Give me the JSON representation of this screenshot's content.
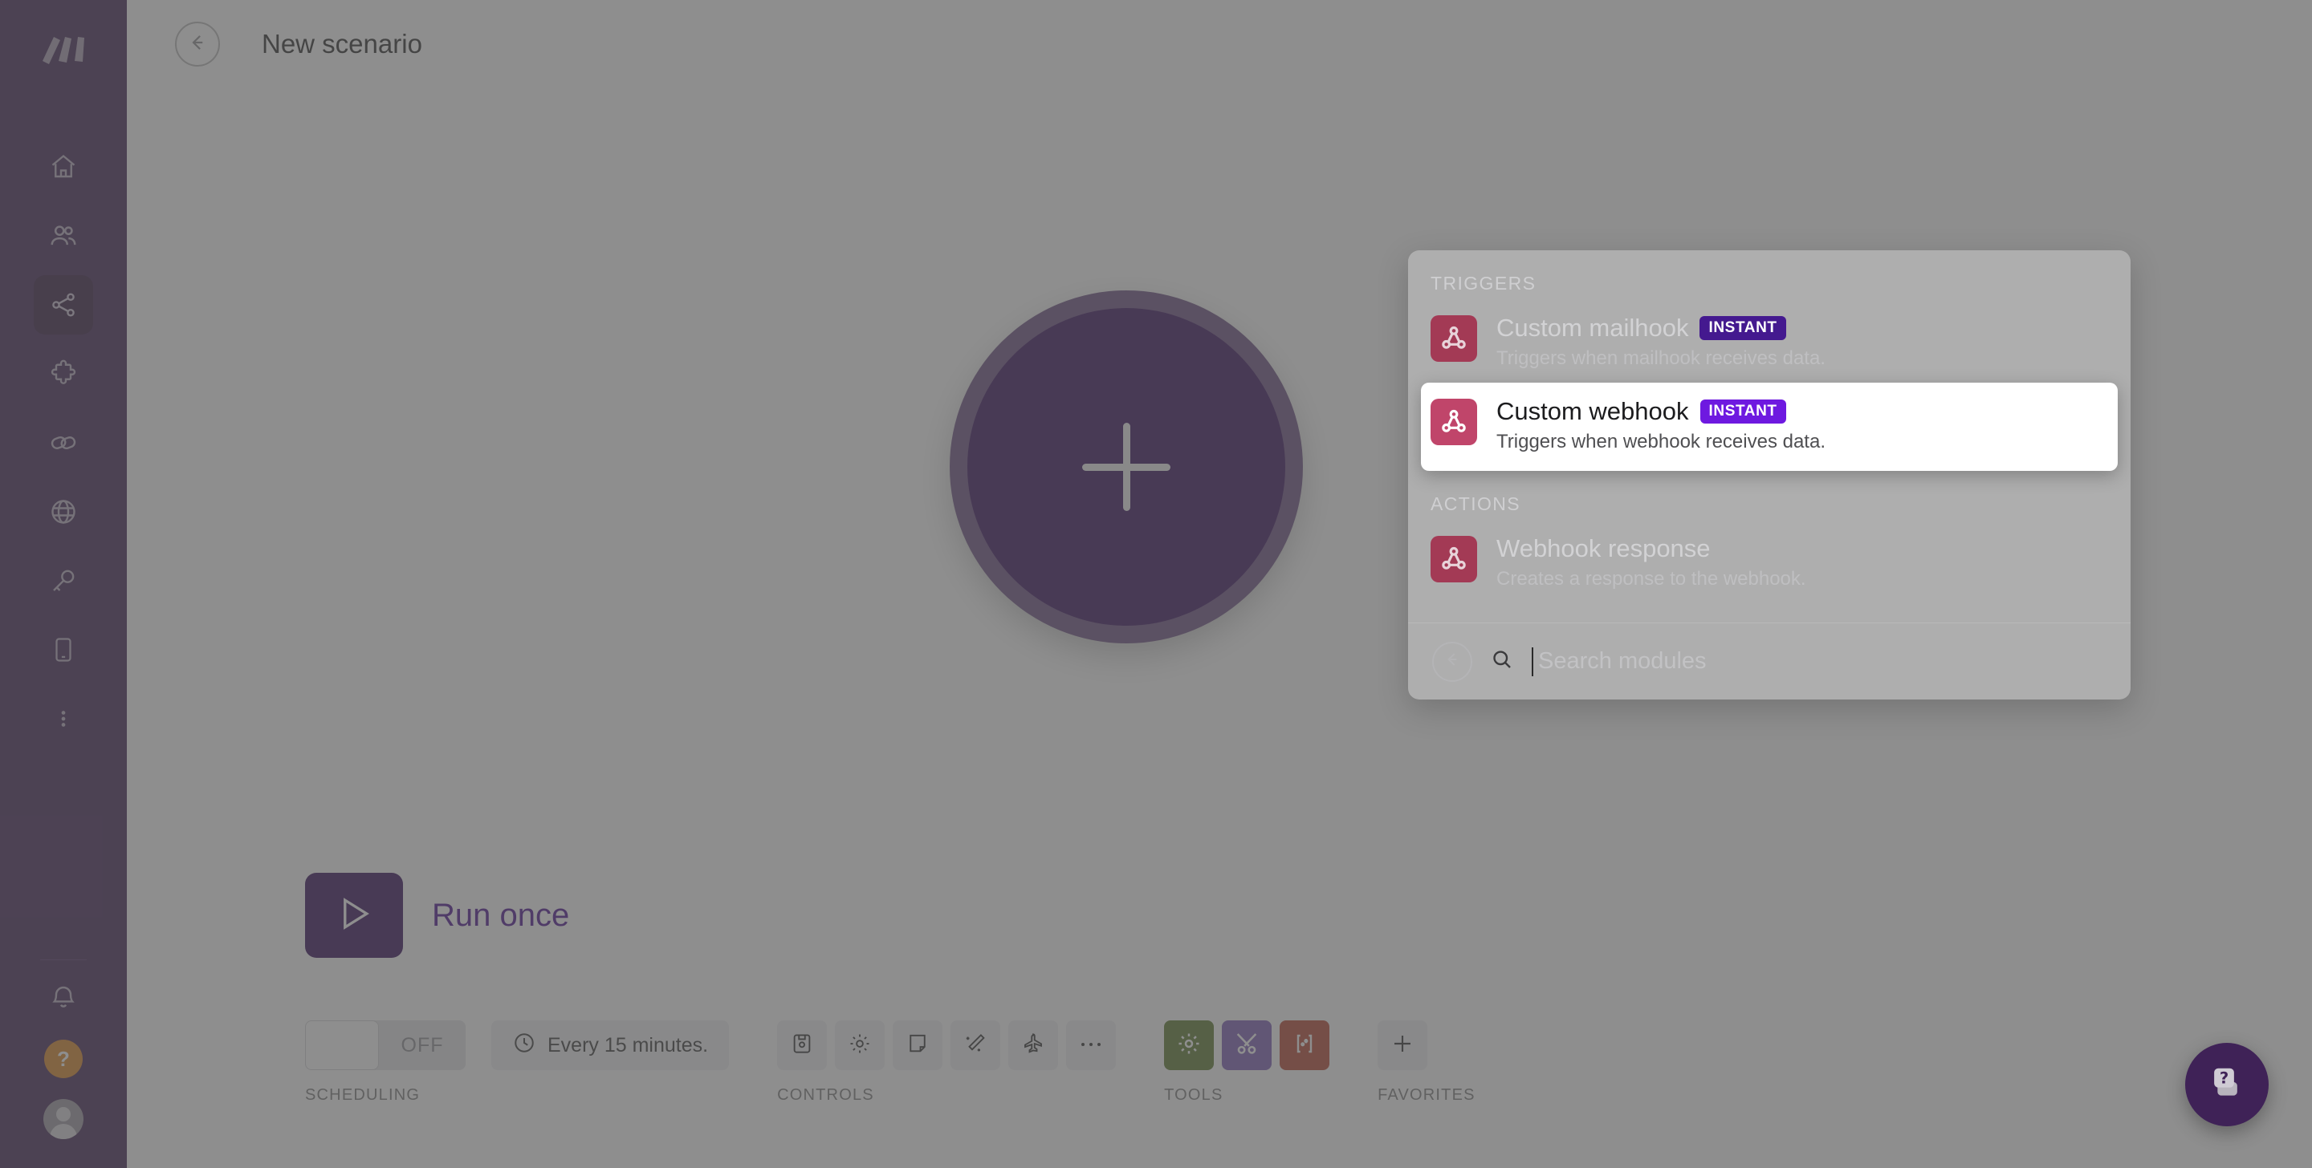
{
  "app": {
    "name": "Make",
    "logo_icon": "make-logo-icon"
  },
  "sidebar": {
    "items": [
      {
        "name": "home",
        "icon": "home-icon",
        "active": false
      },
      {
        "name": "team",
        "icon": "people-icon",
        "active": false
      },
      {
        "name": "scenarios",
        "icon": "share-nodes-icon",
        "active": true
      },
      {
        "name": "templates",
        "icon": "puzzle-piece-icon",
        "active": false
      },
      {
        "name": "connections",
        "icon": "link-icon",
        "active": false
      },
      {
        "name": "webhooks",
        "icon": "globe-icon",
        "active": false
      },
      {
        "name": "keys",
        "icon": "key-icon",
        "active": false
      },
      {
        "name": "devices",
        "icon": "device-icon",
        "active": false
      },
      {
        "name": "more",
        "icon": "more-vertical-icon",
        "active": false
      }
    ],
    "bottom": {
      "notifications_icon": "bell-icon",
      "help_icon": "question-mark-icon",
      "help_label": "?",
      "avatar_icon": "user-avatar-icon"
    }
  },
  "header": {
    "back_icon": "arrow-left-circle-icon",
    "title": "New scenario"
  },
  "canvas": {
    "add_module_icon": "plus-icon",
    "add_module_label": ""
  },
  "run": {
    "play_icon": "play-icon",
    "label": "Run once"
  },
  "scheduling": {
    "group_label": "SCHEDULING",
    "toggle_state": "OFF",
    "clock_icon": "clock-icon",
    "interval_text": "Every 15 minutes."
  },
  "controls": {
    "group_label": "CONTROLS",
    "buttons": [
      {
        "name": "save-scenario",
        "icon": "floppy-disk-icon"
      },
      {
        "name": "scenario-settings",
        "icon": "gear-icon"
      },
      {
        "name": "notes",
        "icon": "note-icon"
      },
      {
        "name": "auto-align",
        "icon": "magic-wand-icon"
      },
      {
        "name": "explain-flow",
        "icon": "airplane-icon"
      },
      {
        "name": "more-controls",
        "icon": "ellipsis-icon"
      }
    ]
  },
  "tools": {
    "group_label": "TOOLS",
    "buttons": [
      {
        "name": "tools-gear",
        "icon": "gear-icon",
        "color": "#5b7a2c"
      },
      {
        "name": "tools-wrench",
        "icon": "tools-icon",
        "color": "#7b5bb5"
      },
      {
        "name": "tools-regex",
        "icon": "regex-icon",
        "color": "#b5452f"
      }
    ]
  },
  "favorites": {
    "group_label": "FAVORITES",
    "add_icon": "plus-icon"
  },
  "picker": {
    "sections": [
      {
        "title": "TRIGGERS",
        "modules": [
          {
            "icon": "webhook-icon",
            "icon_color": "#a33a55",
            "title": "Custom mailhook",
            "badge": "INSTANT",
            "description": "Triggers when mailhook receives data.",
            "highlighted": false
          },
          {
            "icon": "webhook-icon",
            "icon_color": "#c0456a",
            "title": "Custom webhook",
            "badge": "INSTANT",
            "description": "Triggers when webhook receives data.",
            "highlighted": true
          }
        ]
      },
      {
        "title": "ACTIONS",
        "modules": [
          {
            "icon": "webhook-icon",
            "icon_color": "#a33a55",
            "title": "Webhook response",
            "badge": "",
            "description": "Creates a response to the webhook.",
            "highlighted": false
          }
        ]
      }
    ],
    "search": {
      "back_icon": "arrow-left-circle-icon",
      "search_icon": "search-icon",
      "value": "",
      "placeholder": "Search modules"
    }
  },
  "help_fab": {
    "icon": "help-chat-icon"
  },
  "colors": {
    "rail_bg": "#3f2053",
    "accent_purple": "#330a5a",
    "badge_violet": "#6e19e0",
    "webhook_rose": "#c0456a",
    "help_orange": "#d98324"
  }
}
